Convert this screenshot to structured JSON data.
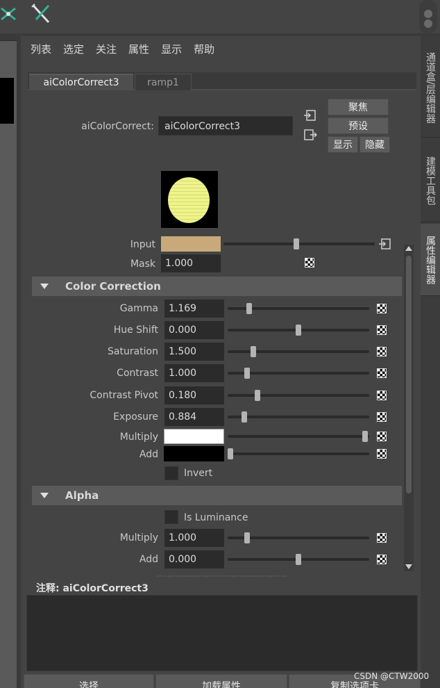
{
  "menu": [
    "列表",
    "选定",
    "关注",
    "属性",
    "显示",
    "帮助"
  ],
  "right_tabs": [
    "通道盒/层编辑器",
    "建模工具包",
    "属性编辑器"
  ],
  "node_tabs": [
    "aiColorCorrect3",
    "ramp1"
  ],
  "node": {
    "label": "aiColorCorrect:",
    "value": "aiColorCorrect3"
  },
  "buttons": {
    "focus": "聚焦",
    "presets": "预设",
    "show": "显示",
    "hide": "隐藏"
  },
  "input_row": {
    "label": "Input",
    "color": "#c8aa7a",
    "slider_fraction": 0.5
  },
  "mask_row": {
    "label": "Mask",
    "value": "1.000"
  },
  "color_correction": {
    "title": "Color Correction",
    "rows": [
      {
        "label": "Gamma",
        "value": "1.169",
        "slider_fraction": 0.14
      },
      {
        "label": "Hue Shift",
        "value": "0.000",
        "slider_fraction": 0.5
      },
      {
        "label": "Saturation",
        "value": "1.500",
        "slider_fraction": 0.17
      },
      {
        "label": "Contrast",
        "value": "1.000",
        "slider_fraction": 0.12
      },
      {
        "label": "Contrast Pivot",
        "value": "0.180",
        "slider_fraction": 0.2
      },
      {
        "label": "Exposure",
        "value": "0.884",
        "slider_fraction": 0.1
      }
    ],
    "multiply": {
      "label": "Multiply",
      "color": "#ffffff",
      "slider_fraction": 0.99
    },
    "add": {
      "label": "Add",
      "color": "#000000",
      "slider_fraction": 0.0
    },
    "invert_label": "Invert"
  },
  "alpha": {
    "title": "Alpha",
    "is_luminance_label": "Is Luminance",
    "rows": [
      {
        "label": "Multiply",
        "value": "1.000",
        "slider_fraction": 0.12
      },
      {
        "label": "Add",
        "value": "0.000",
        "slider_fraction": 0.5
      }
    ]
  },
  "note": {
    "label": "注释:  aiColorCorrect3"
  },
  "bottom_buttons": [
    "选择",
    "加载属性",
    "复制选项卡"
  ],
  "watermark": "CSDN @CTW2000"
}
